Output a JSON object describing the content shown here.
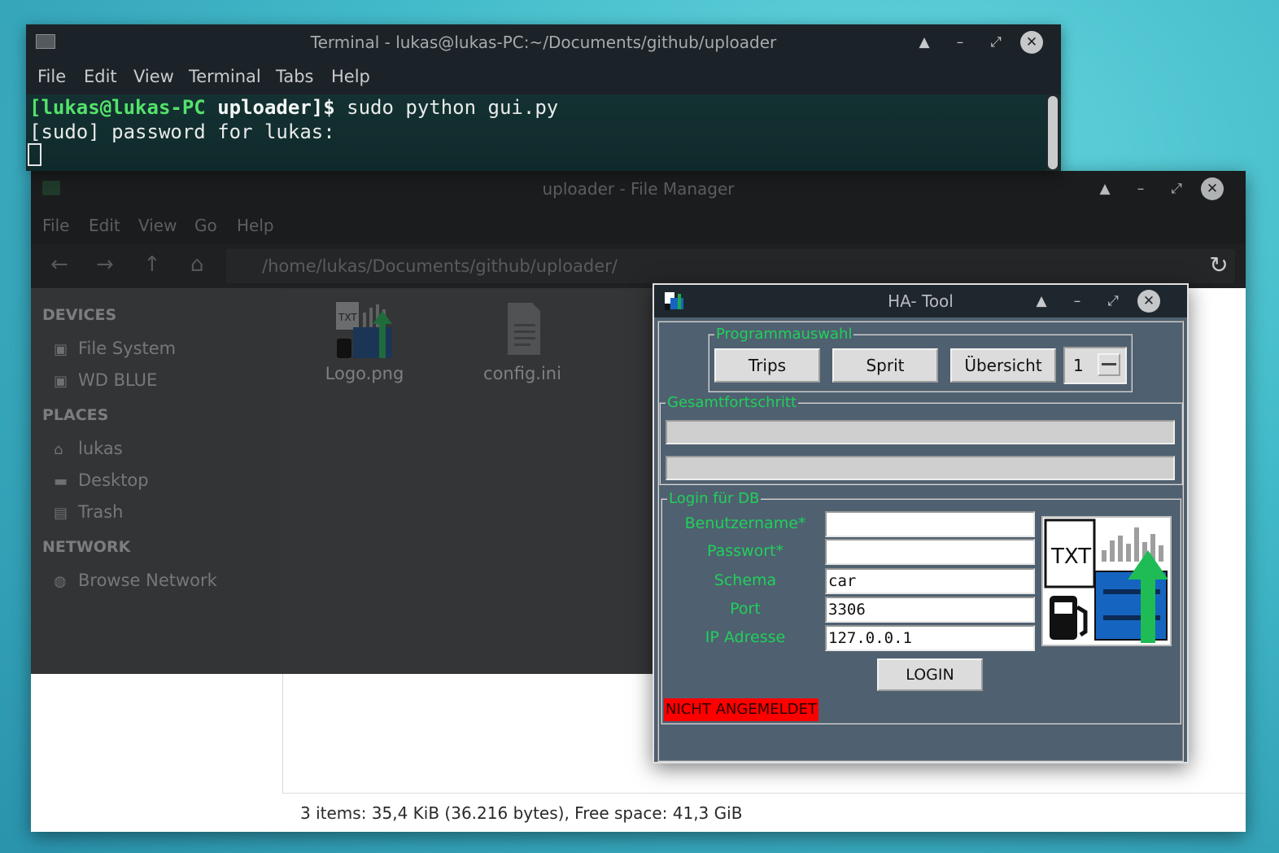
{
  "terminal": {
    "title": "Terminal - lukas@lukas-PC:~/Documents/github/uploader",
    "menu": [
      "File",
      "Edit",
      "View",
      "Terminal",
      "Tabs",
      "Help"
    ],
    "prompt_user": "[lukas@lukas-PC ",
    "prompt_dir": "uploader]$",
    "command": " sudo python gui.py",
    "line2": "[sudo] password for lukas:"
  },
  "file_manager": {
    "title": "uploader - File Manager",
    "menu": [
      "File",
      "Edit",
      "View",
      "Go",
      "Help"
    ],
    "path": "/home/lukas/Documents/github/uploader/",
    "sidebar": {
      "devices_header": "DEVICES",
      "devices": [
        "File System",
        "WD BLUE"
      ],
      "places_header": "PLACES",
      "places": [
        "lukas",
        "Desktop",
        "Trash"
      ],
      "network_header": "NETWORK",
      "network": [
        "Browse Network"
      ]
    },
    "files": [
      "Logo.png",
      "config.ini"
    ],
    "status": "3 items: 35,4 KiB (36.216 bytes), Free space: 41,3 GiB"
  },
  "ha_tool": {
    "title": "HA- Tool",
    "program_group": "Programmauswahl",
    "buttons": [
      "Trips",
      "Sprit",
      "Übersicht"
    ],
    "spinner_value": "1",
    "progress_group": "Gesamtfortschritt",
    "progress": [
      0,
      0
    ],
    "login_group": "Login für DB",
    "fields": [
      {
        "label": "Benutzername*",
        "value": ""
      },
      {
        "label": "Passwort*",
        "value": ""
      },
      {
        "label": "Schema",
        "value": "car"
      },
      {
        "label": "Port",
        "value": "3306"
      },
      {
        "label": "IP Adresse",
        "value": "127.0.0.1"
      }
    ],
    "login_button": "LOGIN",
    "status": "NICHT ANGEMELDET",
    "logo_text": "TXT"
  },
  "colors": {
    "accent_green": "#1fd15a",
    "status_red": "#ff0000",
    "terminal_prompt": "#54e26a"
  }
}
